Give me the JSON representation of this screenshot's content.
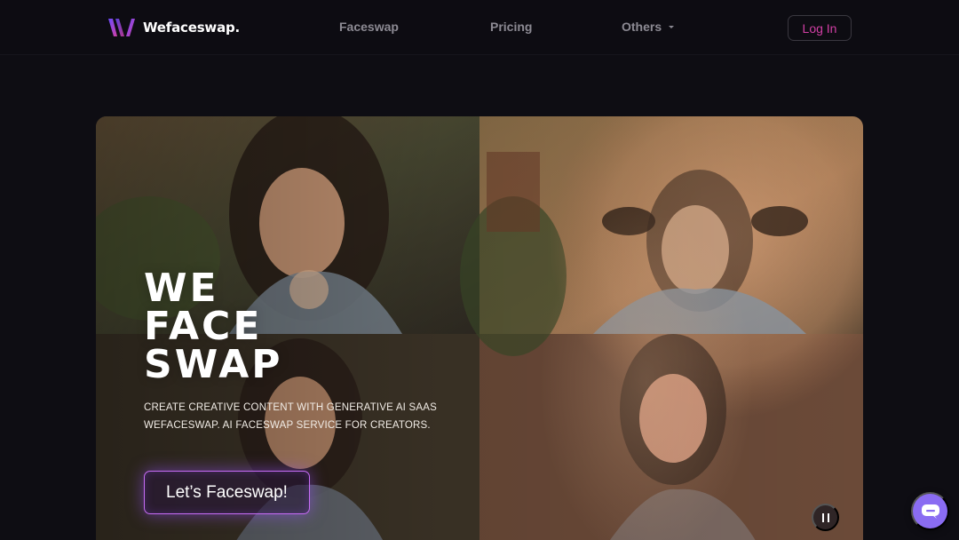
{
  "brand": {
    "name": "Wefaceswap."
  },
  "nav": {
    "items": [
      {
        "label": "Faceswap"
      },
      {
        "label": "Pricing"
      },
      {
        "label": "Others",
        "icon": "caret-down-icon"
      }
    ],
    "login_label": "Log In"
  },
  "hero": {
    "title_lines": [
      "WE",
      "FACE",
      "SWAP"
    ],
    "subtitle_lines": [
      "CREATE CREATIVE CONTENT WITH GENERATIVE AI SAAS",
      "WEFACESWAP. AI FACESWAP SERVICE FOR CREATORS."
    ],
    "cta_label": "Let’s Faceswap!",
    "media_control_icon": "pause-icon"
  },
  "chat": {
    "icon": "chat-bubble-icon"
  },
  "colors": {
    "background": "#0e0d13",
    "login_accent": "#d13fa4",
    "cta_border": "#c76cf5",
    "chat_button": "#8a6cf2",
    "nav_text": "#8c8a93"
  }
}
